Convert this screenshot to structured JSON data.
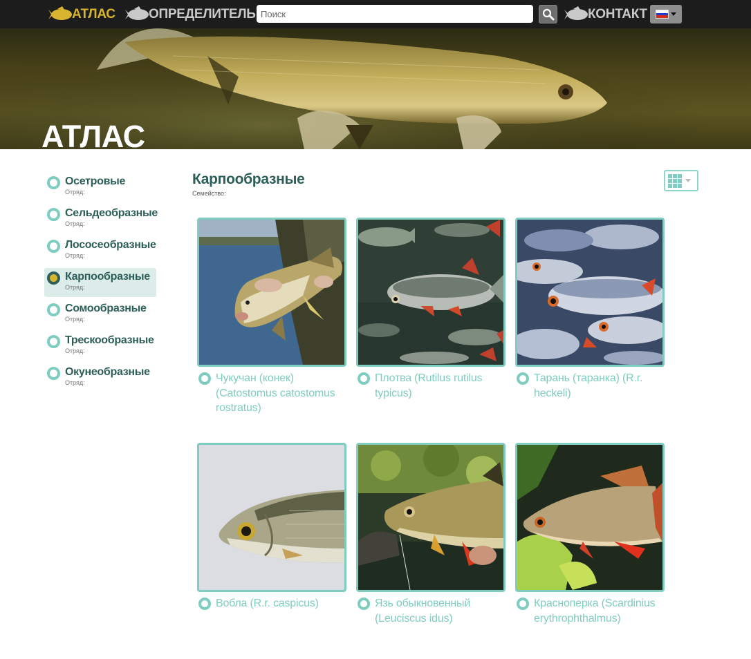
{
  "nav": {
    "atlas_label": "АТЛАС",
    "key_label": "ОПРЕДЕЛИТЕЛЬ",
    "contact_label": "КОНТАКТ",
    "search_placeholder": "Поиск",
    "active_color": "#d8b531",
    "inactive_color": "#c9c9c9"
  },
  "hero": {
    "title": "АТЛАС"
  },
  "sidebar": {
    "items": [
      {
        "name": "Осетровые",
        "sub": "Отряд:",
        "active": false
      },
      {
        "name": "Сельдеобразные",
        "sub": "Отряд:",
        "active": false
      },
      {
        "name": "Лососеобразные",
        "sub": "Отряд:",
        "active": false
      },
      {
        "name": "Карпообразные",
        "sub": "Отряд:",
        "active": true
      },
      {
        "name": "Сомообразные",
        "sub": "Отряд:",
        "active": false
      },
      {
        "name": "Трескообразные",
        "sub": "Отряд:",
        "active": false
      },
      {
        "name": "Окунеобразные",
        "sub": "Отряд:",
        "active": false
      }
    ]
  },
  "main": {
    "title": "Карпообразные",
    "subtitle": "Семейство:"
  },
  "cards": [
    {
      "label": "Чукучан (конек) (Catostomus catostomus rostratus)"
    },
    {
      "label": "Плотва (Rutilus rutilus typicus)"
    },
    {
      "label": "Тарань (таранка) (R.r. heckeli)"
    },
    {
      "label": "Вобла (R.r. caspicus)"
    },
    {
      "label": "Язь обыкновенный (Leuciscus idus)"
    },
    {
      "label": "Красноперка (Scardinius erythrophthalmus)"
    }
  ],
  "colors": {
    "teal": "#7ecdc0",
    "dark_teal": "#2d5f58",
    "gold": "#d8b531",
    "topbar": "#1c1c1c"
  }
}
